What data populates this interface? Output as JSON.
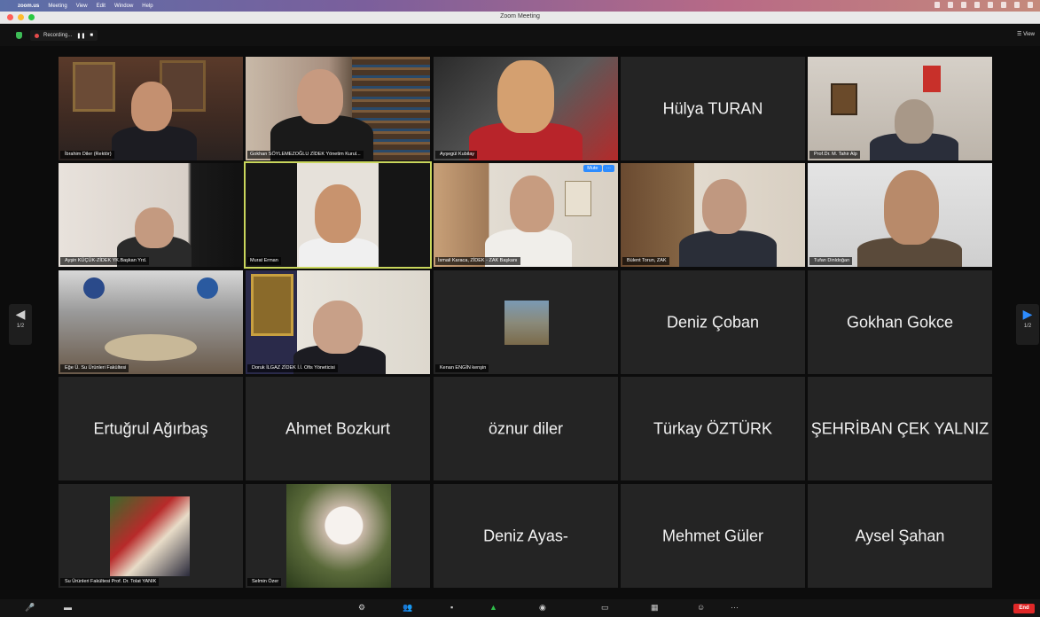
{
  "menubar": {
    "app_name": "zoom.us",
    "menus": [
      "Meeting",
      "View",
      "Edit",
      "Window",
      "Help"
    ]
  },
  "window": {
    "title": "Zoom Meeting"
  },
  "topbar": {
    "recording_label": "Recording...",
    "view_label": "View"
  },
  "pager": {
    "left": "1/2",
    "right": "1/2"
  },
  "participants": [
    {
      "kind": "video",
      "label": "İbrahim Diler (Rektör)"
    },
    {
      "kind": "video",
      "label": "Gokhan SÖYLEMEZOĞLU ZİDEK Yönetim Kurul..."
    },
    {
      "kind": "video",
      "label": "Ayşegül Kubilay"
    },
    {
      "kind": "name",
      "display_name": "Hülya TURAN"
    },
    {
      "kind": "video",
      "label": "Prof.Dr. M. Tahir Alp"
    },
    {
      "kind": "video",
      "label": "Ayşin KÜÇÜK-ZİDEK YK.Başkan Yrd."
    },
    {
      "kind": "video",
      "label": "Murat Erman",
      "active": true
    },
    {
      "kind": "video",
      "label": "İsmail Karaca, ZİDEK - ZAK Başkanı",
      "mute_pill": "Mute"
    },
    {
      "kind": "video",
      "label": "Bülent Torun, ZAK"
    },
    {
      "kind": "video",
      "label": "Tufan Dinldoğan"
    },
    {
      "kind": "video",
      "label": "Eğe Ü. Su Ürünleri Fakültesi"
    },
    {
      "kind": "video",
      "label": "Doruk İLGAZ ZİDEK İ.İ. Ofis Yöneticisi"
    },
    {
      "kind": "photo",
      "label": "Kenan ENGİN kenşin"
    },
    {
      "kind": "name",
      "display_name": "Deniz Çoban"
    },
    {
      "kind": "name",
      "display_name": "Gokhan Gokce"
    },
    {
      "kind": "name",
      "display_name": "Ertuğrul Ağırbaş"
    },
    {
      "kind": "name",
      "display_name": "Ahmet Bozkurt"
    },
    {
      "kind": "name",
      "display_name": "öznur diler"
    },
    {
      "kind": "name",
      "display_name": "Türkay ÖZTÜRK"
    },
    {
      "kind": "name",
      "display_name": "ŞEHRİBAN ÇEK YALNIZ"
    },
    {
      "kind": "photo",
      "label": "Su Ürünleri Fakültesi Prof. Dr. Tolat YANIK"
    },
    {
      "kind": "photo",
      "label": "Selmin Özer"
    },
    {
      "kind": "name",
      "display_name": "Deniz Ayas-"
    },
    {
      "kind": "name",
      "display_name": "Mehmet Güler"
    },
    {
      "kind": "name",
      "display_name": "Aysel Şahan"
    }
  ],
  "toolbar": {
    "end_label": "End"
  },
  "colors": {
    "accent": "#2d8cff",
    "active_speaker": "#c9d65c",
    "end": "#e02828",
    "muted": "#e44444"
  }
}
